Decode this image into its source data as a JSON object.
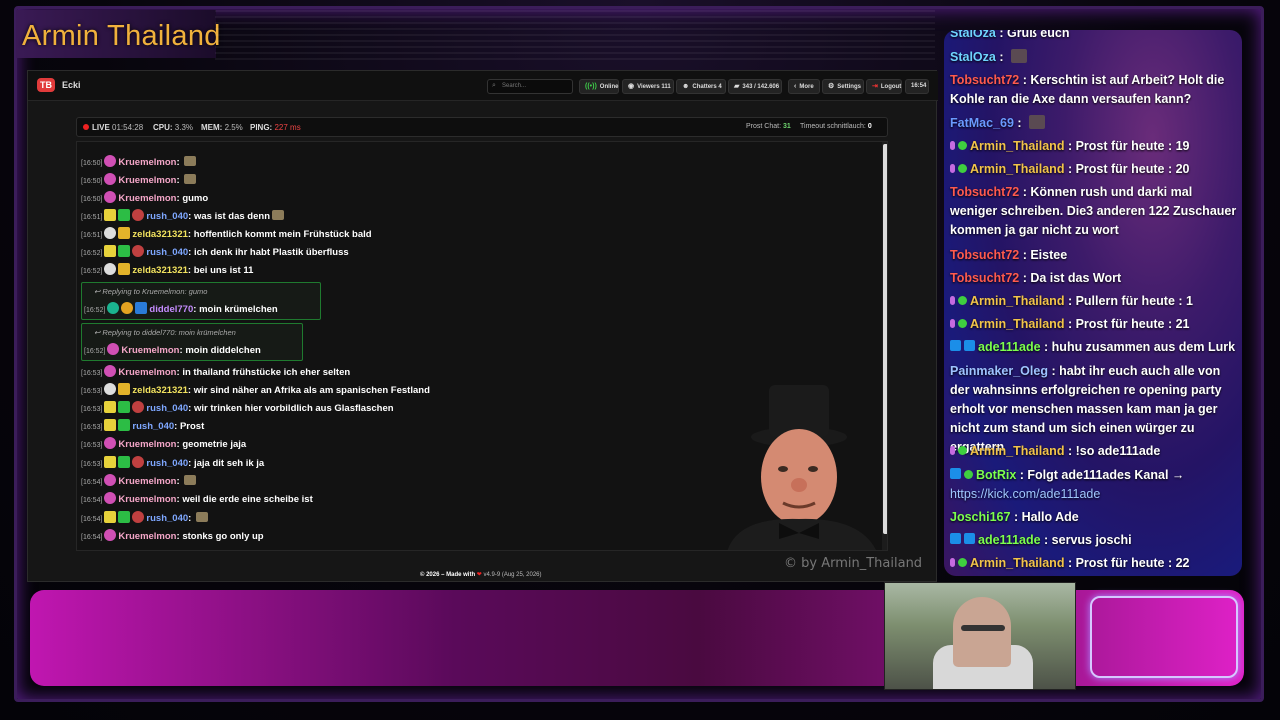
{
  "overlay": {
    "channel_title": "Armin Thailand",
    "watermark": "© by Armin_Thailand"
  },
  "dashboard": {
    "user_name": "Ecki",
    "logo_text": "TB",
    "search_placeholder": "Search...",
    "pills": [
      {
        "name": "online-pill",
        "icon": "broadcast-icon",
        "label": "Online"
      },
      {
        "name": "viewers-pill",
        "icon": "eye-icon",
        "label": "Viewers  111"
      },
      {
        "name": "chatters-pill",
        "icon": "users-icon",
        "label": "Chatters  4"
      },
      {
        "name": "messages-pill",
        "icon": "chat-bubble-icon",
        "label": "343 / 142.606"
      },
      {
        "name": "more-pill",
        "icon": "chevron-left-icon",
        "label": "More"
      },
      {
        "name": "settings-pill",
        "icon": "gear-icon",
        "label": "Settings"
      },
      {
        "name": "logout-pill",
        "icon": "logout-icon",
        "label": "Logout"
      },
      {
        "name": "clock-pill",
        "icon": "",
        "label": "16:54"
      }
    ],
    "status": {
      "live_label": "LIVE",
      "live_time": "01:54:28",
      "cpu_label": "CPU:",
      "cpu_value": "3.3%",
      "mem_label": "MEM:",
      "mem_value": "2.5%",
      "ping_label": "PING:",
      "ping_value": "227 ms",
      "prost_label": "Prost Chat:",
      "prost_value": "31",
      "timeout_label": "Timeout schnittlauch:",
      "timeout_value": "0"
    },
    "messages": [
      {
        "ts": "[16:50]",
        "badges": [
          "pink"
        ],
        "user": "Kruemelmon",
        "color": "pink",
        "text": "",
        "emote": true
      },
      {
        "ts": "[16:50]",
        "badges": [
          "pink"
        ],
        "user": "Kruemelmon",
        "color": "pink",
        "text": "",
        "emote": true
      },
      {
        "ts": "[16:50]",
        "badges": [
          "pink"
        ],
        "user": "Kruemelmon",
        "color": "pink",
        "text": "gumo"
      },
      {
        "ts": "[16:51]",
        "badges": [
          "yellow",
          "green",
          "star"
        ],
        "user": "rush_040",
        "color": "blue",
        "text": "was ist das denn",
        "emote": true
      },
      {
        "ts": "[16:51]",
        "badges": [
          "white",
          "crown"
        ],
        "user": "zelda321321",
        "color": "yellow",
        "text": "hoffentlich kommt mein Frühstück bald"
      },
      {
        "ts": "[16:52]",
        "badges": [
          "yellow",
          "green",
          "star"
        ],
        "user": "rush_040",
        "color": "blue",
        "text": "ich denk ihr habt Plastik überfluss"
      },
      {
        "ts": "[16:52]",
        "badges": [
          "white",
          "crown"
        ],
        "user": "zelda321321",
        "color": "yellow",
        "text": "bei uns ist 11"
      }
    ],
    "reply1": {
      "label": "Replying to Kruemelmon: gumo",
      "ts": "[16:52]",
      "user": "diddel770",
      "text": "moin krümelchen"
    },
    "reply2": {
      "label": "Replying to diddel770: moin krümelchen",
      "ts": "[16:52]",
      "user": "Kruemelmon",
      "text": "moin diddelchen"
    },
    "messages2": [
      {
        "ts": "[16:53]",
        "badges": [
          "pink"
        ],
        "user": "Kruemelmon",
        "color": "pink",
        "text": "in thailand frühstücke ich eher selten"
      },
      {
        "ts": "[16:53]",
        "badges": [
          "white",
          "crown"
        ],
        "user": "zelda321321",
        "color": "yellow",
        "text": "wir sind näher an Afrika als am spanischen Festland"
      },
      {
        "ts": "[16:53]",
        "badges": [
          "yellow",
          "green",
          "star"
        ],
        "user": "rush_040",
        "color": "blue",
        "text": "wir trinken hier vorbildlich aus Glasflaschen"
      },
      {
        "ts": "[16:53]",
        "badges": [
          "yellow",
          "green"
        ],
        "user": "rush_040",
        "color": "blue",
        "text": "Prost"
      },
      {
        "ts": "[16:53]",
        "badges": [
          "pink"
        ],
        "user": "Kruemelmon",
        "color": "pink",
        "text": "geometrie jaja"
      },
      {
        "ts": "[16:53]",
        "badges": [
          "yellow",
          "green",
          "star"
        ],
        "user": "rush_040",
        "color": "blue",
        "text": "jaja dit seh ik ja"
      },
      {
        "ts": "[16:54]",
        "badges": [
          "pink"
        ],
        "user": "Kruemelmon",
        "color": "pink",
        "text": "",
        "emote": true
      },
      {
        "ts": "[16:54]",
        "badges": [
          "pink"
        ],
        "user": "Kruemelmon",
        "color": "pink",
        "text": "weil die erde eine scheibe ist"
      },
      {
        "ts": "[16:54]",
        "badges": [
          "yellow",
          "green",
          "star"
        ],
        "user": "rush_040",
        "color": "blue",
        "text": "",
        "emote": true
      },
      {
        "ts": "[16:54]",
        "badges": [
          "pink"
        ],
        "user": "Kruemelmon",
        "color": "pink",
        "text": "stonks go only up"
      }
    ],
    "footer": {
      "prefix": "© 2026 – Made with",
      "suffix": "v4.9-9 (Aug 25, 2026)"
    }
  },
  "right_chat": [
    {
      "user": "StalOza",
      "color": "teal",
      "text": "Grüß euch",
      "badges": []
    },
    {
      "user": "StalOza",
      "color": "teal",
      "text": "",
      "badges": [],
      "emote": true
    },
    {
      "user": "Tobsucht72",
      "color": "red",
      "text": "Kerschtin ist auf Arbeit? Holt die Kohle ran die Axe dann versaufen kann?",
      "badges": []
    },
    {
      "user": "FatMac_69",
      "color": "blue",
      "text": "",
      "badges": [],
      "emote": true
    },
    {
      "user": "Armin_Thailand",
      "color": "gold",
      "text": "Prost für heute : 19",
      "badges": [
        "mic",
        "check"
      ]
    },
    {
      "user": "Armin_Thailand",
      "color": "gold",
      "text": "Prost für heute : 20",
      "badges": [
        "mic",
        "check"
      ]
    },
    {
      "user": "Tobsucht72",
      "color": "red",
      "text": "Können rush und darki mal weniger schreiben. Die3 anderen 122 Zuschauer kommen ja gar nicht zu wort",
      "badges": []
    },
    {
      "user": "Tobsucht72",
      "color": "red",
      "text": "Eistee",
      "badges": []
    },
    {
      "user": "Tobsucht72",
      "color": "red",
      "text": "Da ist das Wort",
      "badges": []
    },
    {
      "user": "Armin_Thailand",
      "color": "gold",
      "text": "Pullern für heute : 1",
      "badges": [
        "mic",
        "check"
      ]
    },
    {
      "user": "Armin_Thailand",
      "color": "gold",
      "text": "Prost für heute : 21",
      "badges": [
        "mic",
        "check"
      ]
    },
    {
      "user": "ade111ade",
      "color": "lime",
      "text": "huhu zusammen aus dem Lurk",
      "badges": [
        "blue",
        "blue"
      ]
    },
    {
      "user": "Painmaker_Oleg",
      "color": "pl",
      "text": "habt ihr euch auch alle von der wahnsinns erfolgreichen re opening party erholt vor menschen massen kam man ja ger nicht zum stand um sich einen würger zu ergattern",
      "badges": []
    },
    {
      "user": "Armin_Thailand",
      "color": "gold",
      "text": "!so ade111ade",
      "badges": [
        "mic",
        "check"
      ]
    },
    {
      "user": "BotRix",
      "color": "lime",
      "text": "Folgt ade111ades Kanal →",
      "link": "https://kick.com/ade111ade",
      "badges": [
        "blue",
        "check"
      ]
    },
    {
      "user": "Joschi167",
      "color": "lime",
      "text": "Hallo Ade",
      "badges": []
    },
    {
      "user": "ade111ade",
      "color": "lime",
      "text": "servus joschi",
      "badges": [
        "blue",
        "blue"
      ]
    },
    {
      "user": "Armin_Thailand",
      "color": "gold",
      "text": "Prost für heute : 22",
      "badges": [
        "mic",
        "check"
      ]
    }
  ]
}
